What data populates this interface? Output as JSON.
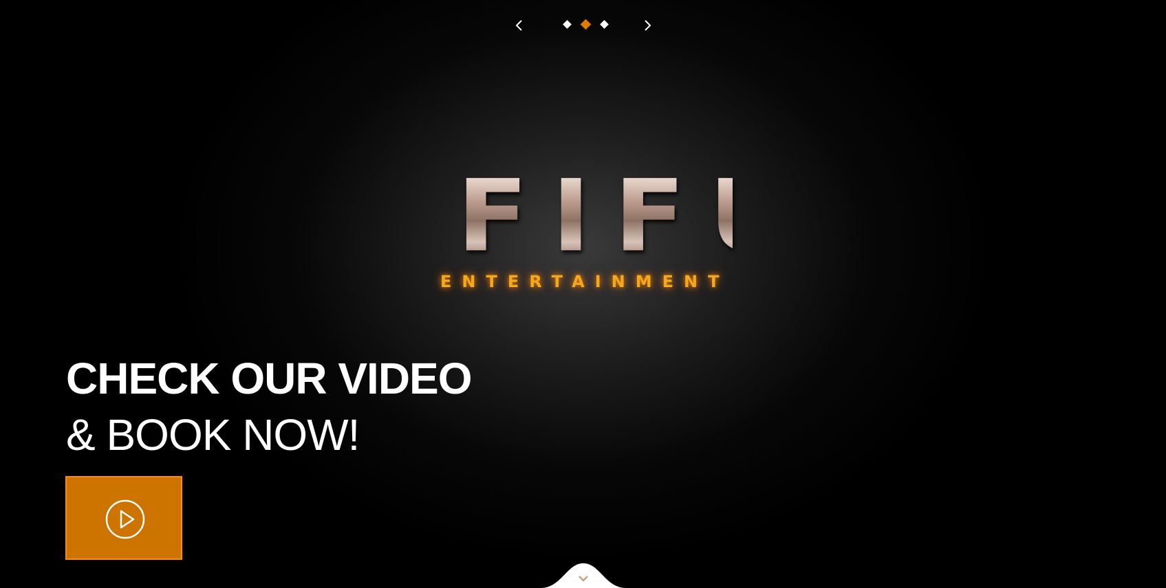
{
  "slider": {
    "prev_icon": "chevron-left-icon",
    "next_icon": "chevron-right-icon",
    "dots": [
      "inactive",
      "active",
      "inactive"
    ],
    "active_index": 1,
    "active_color": "#e07b00",
    "inactive_color": "#ffffff"
  },
  "logo": {
    "main": "FIFU",
    "sub": "ENTERTAINMENT"
  },
  "headline": {
    "line1": "CHECK OUR VIDEO",
    "line2": "& BOOK NOW!"
  },
  "play_button": {
    "icon": "play-circle-icon",
    "background": "#cc7300"
  },
  "scroll_down": {
    "icon": "chevron-down-icon"
  }
}
